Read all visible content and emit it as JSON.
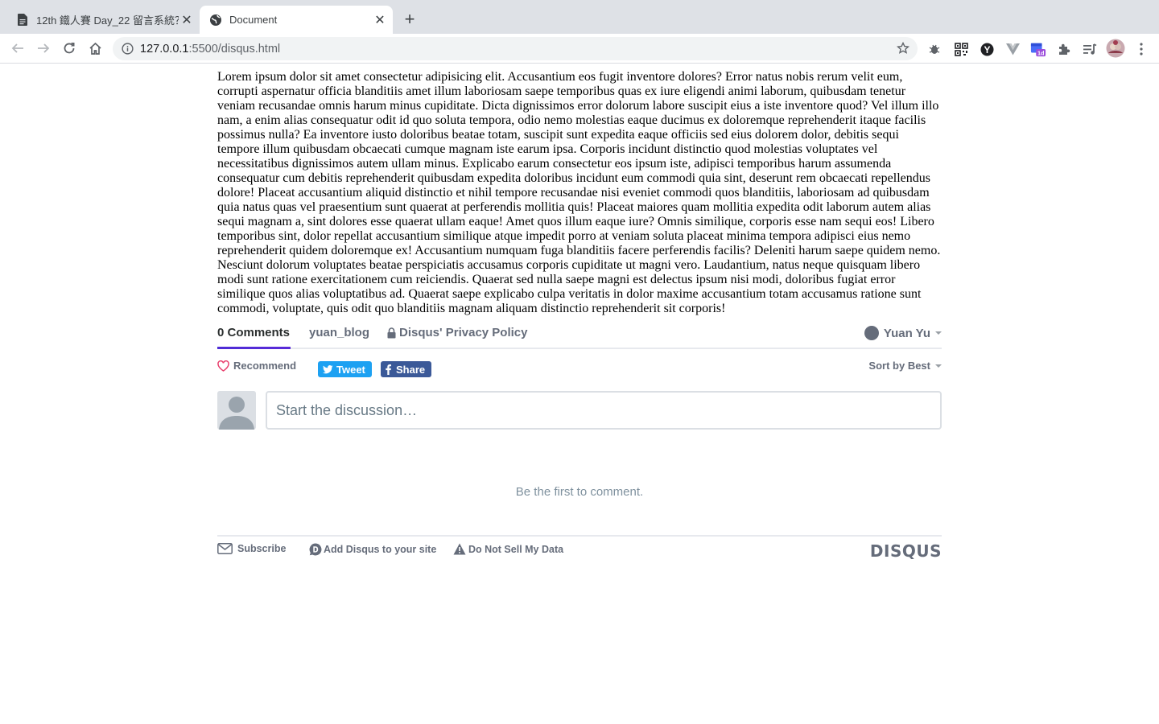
{
  "browser": {
    "tabs": [
      {
        "title": "12th 鐵人賽 Day_22 留言系統？",
        "active": false,
        "icon": "document-icon"
      },
      {
        "title": "Document",
        "active": true,
        "icon": "globe-icon"
      }
    ],
    "url_host": "127.0.0.1",
    "url_rest": ":5500/disqus.html",
    "extension_badge": "1d"
  },
  "article": {
    "text": "Lorem ipsum dolor sit amet consectetur adipisicing elit. Accusantium eos fugit inventore dolores? Error natus nobis rerum velit eum, corrupti aspernatur officia blanditiis amet illum laboriosam saepe temporibus quas ex iure eligendi animi laborum, quibusdam tenetur veniam recusandae omnis harum minus cupiditate. Dicta dignissimos error dolorum labore suscipit eius a iste inventore quod? Vel illum illo nam, a enim alias consequatur odit id quo soluta tempora, odio nemo molestias eaque ducimus ex doloremque reprehenderit itaque facilis possimus nulla? Ea inventore iusto doloribus beatae totam, suscipit sunt expedita eaque officiis sed eius dolorem dolor, debitis sequi tempore illum quibusdam obcaecati cumque magnam iste earum ipsa. Corporis incidunt distinctio quod molestias voluptates vel necessitatibus dignissimos autem ullam minus. Explicabo earum consectetur eos ipsum iste, adipisci temporibus harum assumenda consequatur cum debitis reprehenderit quibusdam expedita doloribus incidunt eum commodi quia sint, deserunt rem obcaecati repellendus dolore! Placeat accusantium aliquid distinctio et nihil tempore recusandae nisi eveniet commodi quos blanditiis, laboriosam ad quibusdam quia natus quas vel praesentium sunt quaerat at perferendis mollitia quis! Placeat maiores quam mollitia expedita odit laborum autem alias sequi magnam a, sint dolores esse quaerat ullam eaque! Amet quos illum eaque iure? Omnis similique, corporis esse nam sequi eos! Libero temporibus sint, dolor repellat accusantium similique atque impedit porro at veniam soluta placeat minima tempora adipisci eius nemo reprehenderit quidem doloremque ex! Accusantium numquam fuga blanditiis facere perferendis facilis? Deleniti harum saepe quidem nemo. Nesciunt dolorum voluptates beatae perspiciatis accusamus corporis cupiditate ut magni vero. Laudantium, natus neque quisquam libero modi sunt ratione exercitationem cum reiciendis. Quaerat sed nulla saepe magni est delectus ipsum nisi modi, doloribus fugiat error similique quos alias voluptatibus ad. Quaerat saepe explicabo culpa veritatis in dolor maxime accusantium totam accusamus ratione sunt commodi, voluptate, quis odit quo blanditiis magnam aliquam distinctio reprehenderit sit corporis!"
  },
  "disqus": {
    "nav": {
      "comments": "0 Comments",
      "forum": "yuan_blog",
      "privacy": "Disqus' Privacy Policy",
      "user": "Yuan Yu"
    },
    "actions": {
      "recommend": "Recommend",
      "tweet": "Tweet",
      "share": "Share",
      "sort": "Sort by Best"
    },
    "compose_placeholder": "Start the discussion…",
    "empty_message": "Be the first to comment.",
    "footer": {
      "subscribe": "Subscribe",
      "add_disqus": "Add Disqus to your site",
      "do_not_sell": "Do Not Sell My Data",
      "logo": "DISQUS"
    },
    "colors": {
      "accent": "#2e9fff",
      "tweet": "#1da1f2",
      "facebook": "#3b5998",
      "text_muted": "#656c7a"
    }
  }
}
